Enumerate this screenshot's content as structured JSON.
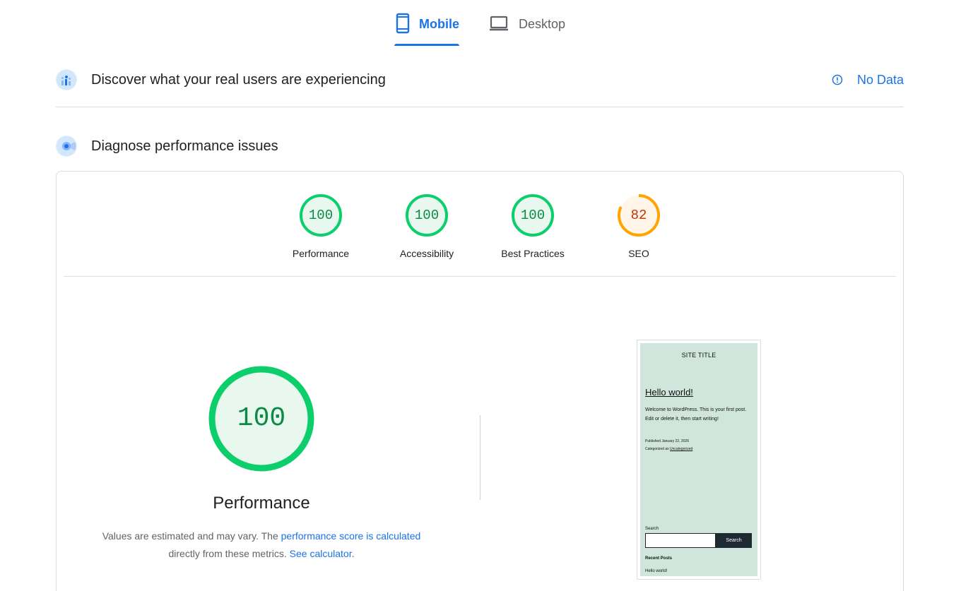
{
  "tabs": {
    "mobile": "Mobile",
    "desktop": "Desktop"
  },
  "section_real_users": {
    "title": "Discover what your real users are experiencing",
    "status": "No Data"
  },
  "section_diagnose": {
    "title": "Diagnose performance issues"
  },
  "scores": [
    {
      "label": "Performance",
      "value": "100",
      "fraction": 1.0,
      "color": "#0cce6b",
      "text_color": "#0a8a44",
      "fill": "#e8f8ee"
    },
    {
      "label": "Accessibility",
      "value": "100",
      "fraction": 1.0,
      "color": "#0cce6b",
      "text_color": "#0a8a44",
      "fill": "#e8f8ee"
    },
    {
      "label": "Best Practices",
      "value": "100",
      "fraction": 1.0,
      "color": "#0cce6b",
      "text_color": "#0a8a44",
      "fill": "#e8f8ee"
    },
    {
      "label": "SEO",
      "value": "82",
      "fraction": 0.82,
      "color": "#ffa400",
      "text_color": "#c33300",
      "fill": "#fff5e8"
    }
  ],
  "performance": {
    "score": "100",
    "title": "Performance",
    "desc_prefix": "Values are estimated and may vary. The ",
    "desc_link": "performance score is calculated",
    "desc_mid": "directly from these metrics.",
    "desc_link2": "See calculator",
    "desc_suffix": "."
  },
  "preview": {
    "site_title": "SITE TITLE",
    "post_title": "Hello world!",
    "post_body": "Welcome to WordPress. This is your first post. Edit or delete it, then start writing!",
    "published": "Published January 22, 2026",
    "categorized_prefix": "Categorized as ",
    "category": "Uncategorized",
    "search_label": "Search",
    "search_button": "Search",
    "recent_posts": "Recent Posts",
    "recent_item": "Hello world!"
  },
  "colors": {
    "accent": "#1a73e8",
    "pass": "#0cce6b",
    "average": "#ffa400"
  }
}
